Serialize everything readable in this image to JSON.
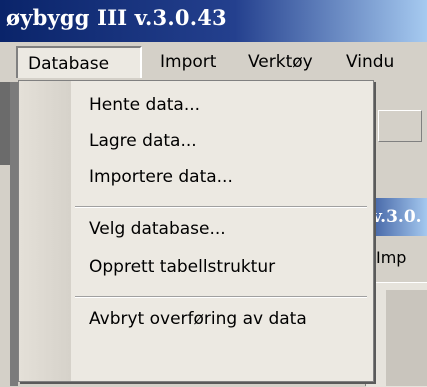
{
  "window": {
    "title": "øybygg III v.3.0.43"
  },
  "menubar": {
    "items": [
      {
        "label": "Database"
      },
      {
        "label": "Import"
      },
      {
        "label": "Verktøy"
      },
      {
        "label": "Vindu"
      }
    ]
  },
  "dropdown": {
    "items": [
      {
        "label": "Hente data..."
      },
      {
        "label": "Lagre data..."
      },
      {
        "label": "Importere data..."
      },
      {
        "label": "Velg database..."
      },
      {
        "label": "Opprett tabellstruktur"
      },
      {
        "label": "Avbryt overføring av data"
      }
    ]
  },
  "background_window": {
    "title": "v.3.0.",
    "menu_label": "Imp"
  }
}
